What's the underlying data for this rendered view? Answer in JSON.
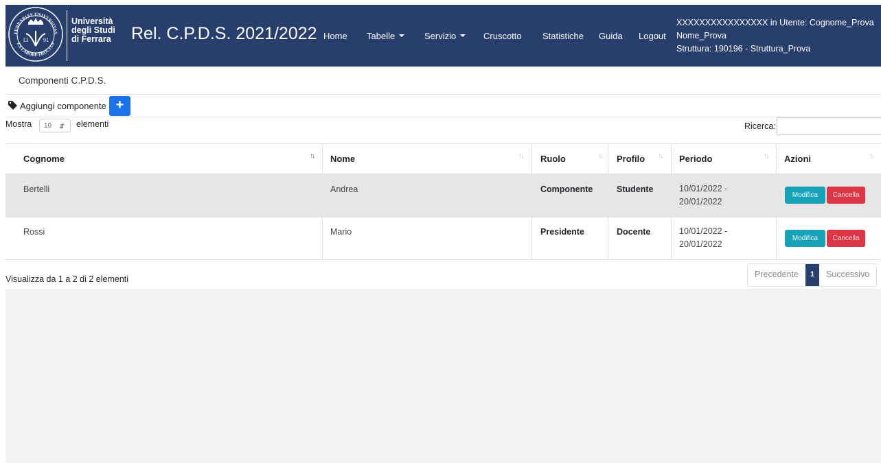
{
  "header": {
    "logo_lines": [
      "Università",
      "degli Studi",
      "di Ferrara"
    ],
    "seal_text_top": "FERRARIAE UNIVERSITAS",
    "seal_text_bottom": "EX LABORE FRUCTUS",
    "seal_year_left": "13",
    "seal_year_right": "91",
    "app_title": "Rel. C.P.D.S. 2021/2022",
    "nav": {
      "home": "Home",
      "tabelle": "Tabelle",
      "servizio": "Servizio",
      "cruscotto": "Cruscotto",
      "statistiche": "Statistiche",
      "guida": "Guida",
      "logout": "Logout"
    },
    "user": {
      "line1": "XXXXXXXXXXXXXXXX in Utente: Cognome_Prova",
      "line2": "Nome_Prova",
      "line3": "Struttura: 190196 - Struttura_Prova"
    }
  },
  "card": {
    "title": "Componenti C.P.D.S.",
    "add_label": "Aggiungi componente",
    "add_button": "+",
    "length_prefix": "Mostra",
    "length_value": "10",
    "length_suffix": "elementi",
    "search_label": "Ricerca:",
    "search_value": ""
  },
  "table": {
    "columns": [
      "Cognome",
      "Nome",
      "Ruolo",
      "Profilo",
      "Periodo",
      "Azioni"
    ],
    "rows": [
      {
        "cognome": "Bertelli",
        "nome": "Andrea",
        "ruolo": "Componente",
        "profilo": "Studente",
        "periodo_1": "10/01/2022 -",
        "periodo_2": "20/01/2022",
        "edit_label": "Modifica",
        "delete_label": "Cancella"
      },
      {
        "cognome": "Rossi",
        "nome": "Mario",
        "ruolo": "Presidente",
        "profilo": "Docente",
        "periodo_1": "10/01/2022 -",
        "periodo_2": "20/01/2022",
        "edit_label": "Modifica",
        "delete_label": "Cancella"
      }
    ],
    "info": "Visualizza da 1 a 2 di 2 elementi",
    "pager": {
      "prev": "Precedente",
      "current": "1",
      "next": "Successivo"
    }
  },
  "colors": {
    "navbar": "#283e6d",
    "add_button": "#1a73e8",
    "edit_button": "#17a2b8",
    "delete_button": "#dc3545",
    "row_highlight": "#e6e6e6",
    "page_background": "#f2f2f2"
  },
  "icons": {
    "tag": "tag-icon",
    "sort_active": "sort-asc-icon",
    "sort": "sort-both-icon",
    "select_arrow": "chevron-updown-icon"
  }
}
